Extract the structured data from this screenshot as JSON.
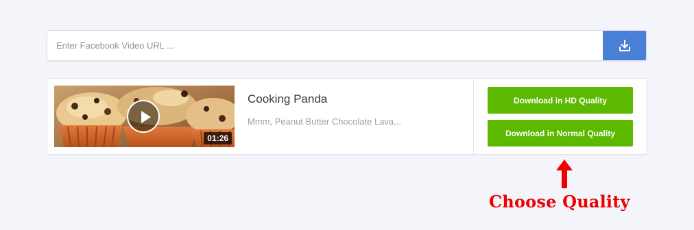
{
  "search": {
    "placeholder": "Enter Facebook Video URL ...",
    "value": "",
    "submit_icon": "download-icon",
    "accent_color": "#4a7fd6"
  },
  "result": {
    "thumbnail_description_icon": "play-icon",
    "duration": "01:26",
    "title": "Cooking Panda",
    "description": "Mmm, Peanut Butter Chocolate Lava...",
    "buttons": {
      "hd_label": "Download in HD Quality",
      "normal_label": "Download in Normal Quality",
      "color": "#5cb900"
    }
  },
  "annotation": {
    "text": "Choose Quality",
    "color": "#ee0000",
    "arrow_icon": "arrow-up-icon"
  }
}
